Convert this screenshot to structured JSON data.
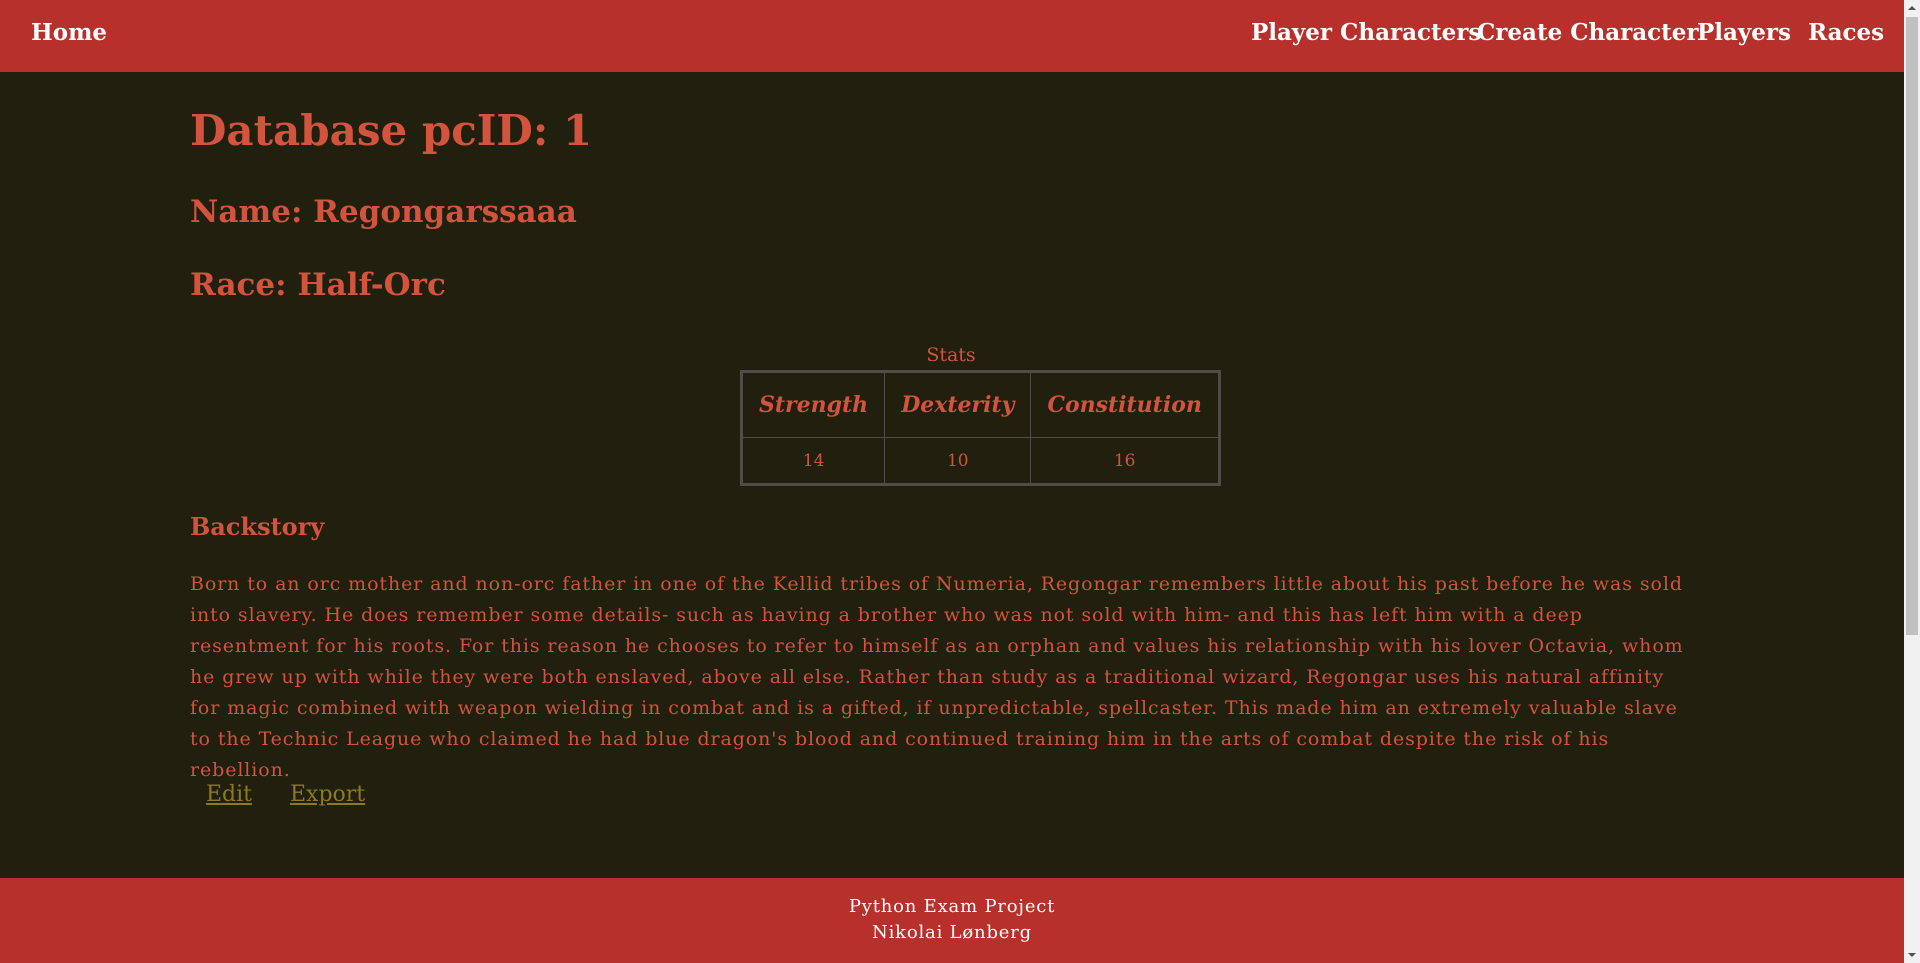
{
  "nav": {
    "home": "Home",
    "player_characters": "Player Characters",
    "create_character": "Create Character",
    "players": "Players",
    "races": "Races"
  },
  "character": {
    "id_heading": "Database pcID: 1",
    "name_heading": "Name: Regongarssaaa",
    "race_heading": "Race: Half-Orc"
  },
  "stats": {
    "caption": "Stats",
    "headers": [
      "Strength",
      "Dexterity",
      "Constitution"
    ],
    "values": [
      "14",
      "10",
      "16"
    ]
  },
  "backstory": {
    "heading": "Backstory",
    "text": "Born to an orc mother and non-orc father in one of the Kellid tribes of Numeria, Regongar remembers little about his past before he was sold into slavery. He does remember some details- such as having a brother who was not sold with him- and this has left him with a deep resentment for his roots. For this reason he chooses to refer to himself as an orphan and values his relationship with his lover Octavia, whom he grew up with while they were both enslaved, above all else. Rather than study as a traditional wizard, Regongar uses his natural affinity for magic combined with weapon wielding in combat and is a gifted, if unpredictable, spellcaster. This made him an extremely valuable slave to the Technic League who claimed he had blue dragon's blood and continued training him in the arts of combat despite the risk of his rebellion."
  },
  "actions": {
    "edit": "Edit",
    "export": "Export"
  },
  "footer": {
    "line1": "Python Exam Project",
    "line2": "Nikolai Lønberg"
  },
  "colors": {
    "navbar": "#b8302c",
    "background": "#211f0e",
    "text": "#d2543e",
    "link": "#8b7a22"
  }
}
